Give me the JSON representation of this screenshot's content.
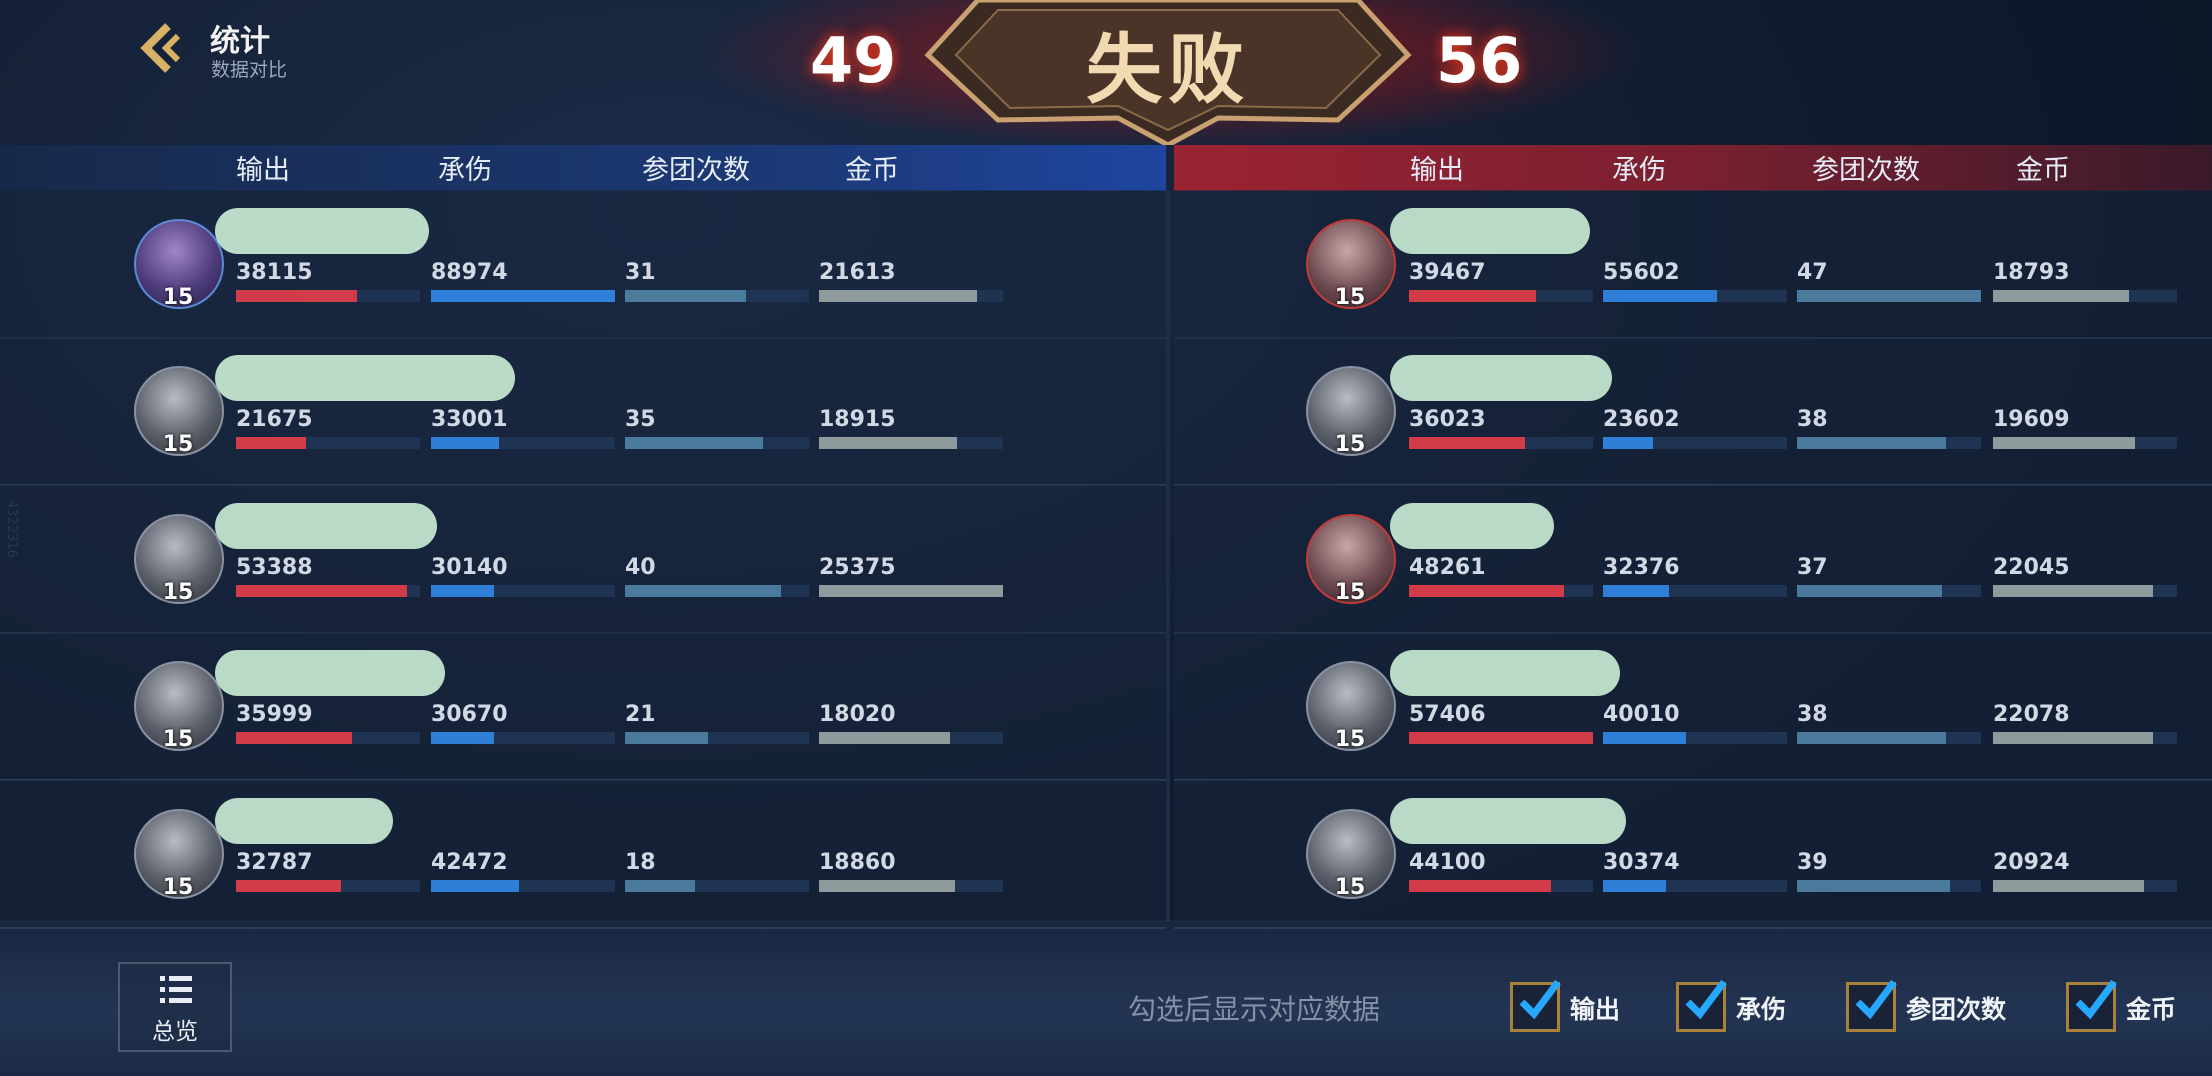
{
  "header": {
    "title": "统计",
    "subtitle": "数据对比",
    "score_left": "49",
    "score_right": "56",
    "result": "失败"
  },
  "columns_left": [
    "输出",
    "承伤",
    "参团次数",
    "金币"
  ],
  "columns_right": [
    "输出",
    "承伤",
    "参团次数",
    "金币"
  ],
  "side_id": "4322316",
  "left_team": [
    {
      "level": "15",
      "stats": [
        "38115",
        "88974",
        "31",
        "21613"
      ],
      "fill": [
        0.66,
        1.0,
        0.66,
        0.86
      ]
    },
    {
      "level": "15",
      "stats": [
        "21675",
        "33001",
        "35",
        "18915"
      ],
      "fill": [
        0.38,
        0.37,
        0.75,
        0.75
      ]
    },
    {
      "level": "15",
      "stats": [
        "53388",
        "30140",
        "40",
        "25375"
      ],
      "fill": [
        0.93,
        0.34,
        0.85,
        1.0
      ]
    },
    {
      "level": "15",
      "stats": [
        "35999",
        "30670",
        "21",
        "18020"
      ],
      "fill": [
        0.63,
        0.34,
        0.45,
        0.71
      ]
    },
    {
      "level": "15",
      "stats": [
        "32787",
        "42472",
        "18",
        "18860"
      ],
      "fill": [
        0.57,
        0.48,
        0.38,
        0.74
      ]
    }
  ],
  "right_team": [
    {
      "level": "15",
      "stats": [
        "39467",
        "55602",
        "47",
        "18793"
      ],
      "fill": [
        0.69,
        0.62,
        1.0,
        0.74
      ]
    },
    {
      "level": "15",
      "stats": [
        "36023",
        "23602",
        "38",
        "19609"
      ],
      "fill": [
        0.63,
        0.27,
        0.81,
        0.77
      ]
    },
    {
      "level": "15",
      "stats": [
        "48261",
        "32376",
        "37",
        "22045"
      ],
      "fill": [
        0.84,
        0.36,
        0.79,
        0.87
      ]
    },
    {
      "level": "15",
      "stats": [
        "57406",
        "40010",
        "38",
        "22078"
      ],
      "fill": [
        1.0,
        0.45,
        0.81,
        0.87
      ]
    },
    {
      "level": "15",
      "stats": [
        "44100",
        "30374",
        "39",
        "20924"
      ],
      "fill": [
        0.77,
        0.34,
        0.83,
        0.82
      ]
    }
  ],
  "footer": {
    "overview_label": "总览",
    "hint": "勾选后显示对应数据",
    "checkboxes": [
      {
        "label": "输出",
        "checked": true
      },
      {
        "label": "承伤",
        "checked": true
      },
      {
        "label": "参团次数",
        "checked": true
      },
      {
        "label": "金币",
        "checked": true
      }
    ]
  },
  "colors": {
    "output": "#d23c48",
    "damage_taken": "#2f7fd8",
    "teamfight": "#4a7a9c",
    "gold": "#8e9a9c",
    "ally_bar": "#1f45a0",
    "enemy_bar": "#9a2232"
  },
  "icons": {
    "back": "chevron-left-icon",
    "overview": "list-icon",
    "checkbox": "checkmark-icon"
  }
}
